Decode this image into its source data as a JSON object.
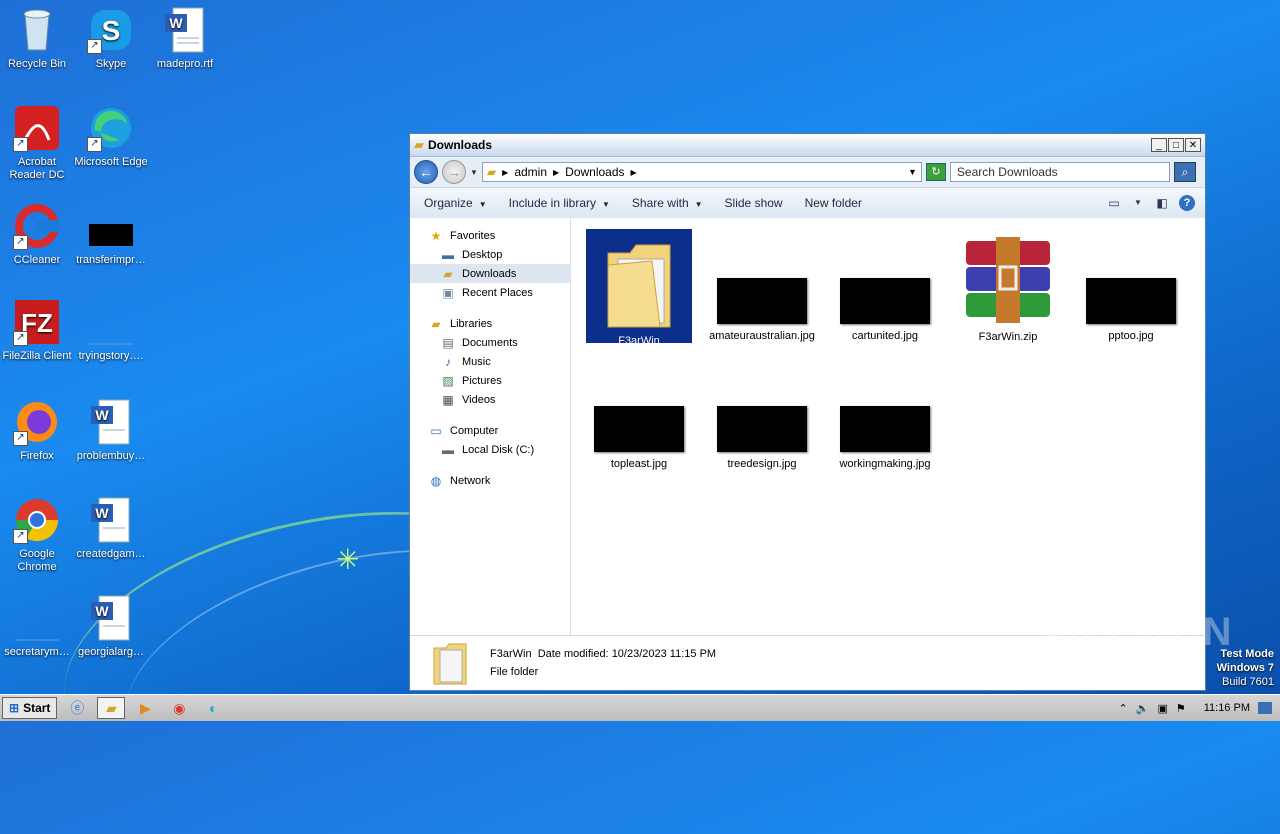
{
  "desktop": {
    "icons": [
      {
        "label": "Recycle Bin"
      },
      {
        "label": "Skype"
      },
      {
        "label": "madepro.rtf"
      },
      {
        "label": "Acrobat Reader DC"
      },
      {
        "label": "Microsoft Edge"
      },
      {
        "label": "CCleaner"
      },
      {
        "label": "transferimpr…"
      },
      {
        "label": "FileZilla Client"
      },
      {
        "label": "tryingstory…."
      },
      {
        "label": "Firefox"
      },
      {
        "label": "problembuy…"
      },
      {
        "label": "Google Chrome"
      },
      {
        "label": "createdgam…"
      },
      {
        "label": "secretarym…"
      },
      {
        "label": "georgialarg…"
      }
    ]
  },
  "window": {
    "title": "Downloads",
    "breadcrumb": [
      "admin",
      "Downloads"
    ],
    "search_placeholder": "Search Downloads",
    "toolbar": {
      "organize": "Organize",
      "include": "Include in library",
      "share": "Share with",
      "slideshow": "Slide show",
      "newfolder": "New folder"
    },
    "nav": {
      "favorites": "Favorites",
      "desktop": "Desktop",
      "downloads": "Downloads",
      "recent": "Recent Places",
      "libraries": "Libraries",
      "documents": "Documents",
      "music": "Music",
      "pictures": "Pictures",
      "videos": "Videos",
      "computer": "Computer",
      "localdisk": "Local Disk (C:)",
      "network": "Network"
    },
    "files": [
      {
        "name": "F3arWin"
      },
      {
        "name": "amateuraustralian.jpg"
      },
      {
        "name": "cartunited.jpg"
      },
      {
        "name": "F3arWin.zip"
      },
      {
        "name": "pptoo.jpg"
      },
      {
        "name": "topleast.jpg"
      },
      {
        "name": "treedesign.jpg"
      },
      {
        "name": "workingmaking.jpg"
      }
    ],
    "details": {
      "name": "F3arWin",
      "modified_label": "Date modified:",
      "modified_value": "10/23/2023 11:15 PM",
      "type": "File folder"
    }
  },
  "taskbar": {
    "start": "Start",
    "clock": "11:16 PM"
  },
  "watermark": {
    "mode": "Test Mode",
    "os": "Windows 7",
    "build": "Build 7601",
    "brand": "ANY RUN"
  }
}
